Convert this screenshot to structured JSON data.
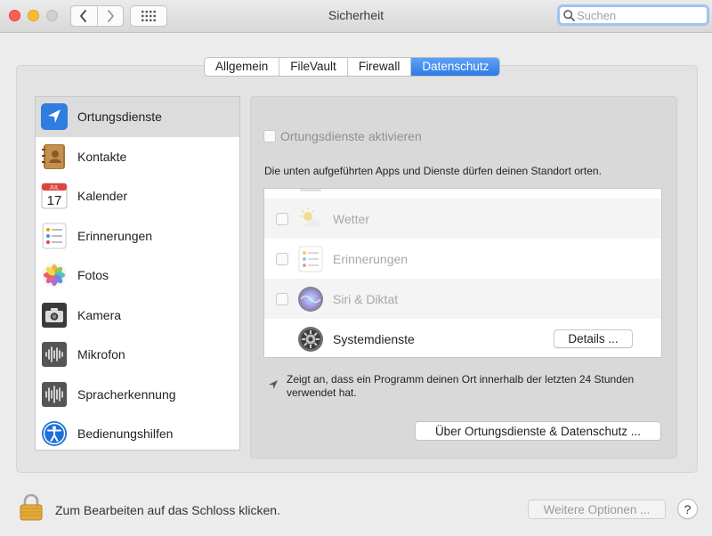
{
  "window": {
    "title": "Sicherheit",
    "search_placeholder": "Suchen"
  },
  "tabs": [
    {
      "label": "Allgemein",
      "active": false
    },
    {
      "label": "FileVault",
      "active": false
    },
    {
      "label": "Firewall",
      "active": false
    },
    {
      "label": "Datenschutz",
      "active": true
    }
  ],
  "sidebar": {
    "items": [
      {
        "label": "Ortungsdienste",
        "icon": "location-arrow-icon",
        "selected": true
      },
      {
        "label": "Kontakte",
        "icon": "contacts-book-icon"
      },
      {
        "label": "Kalender",
        "icon": "calendar-icon",
        "month": "JUL",
        "day": "17"
      },
      {
        "label": "Erinnerungen",
        "icon": "reminders-icon"
      },
      {
        "label": "Fotos",
        "icon": "photos-flower-icon"
      },
      {
        "label": "Kamera",
        "icon": "camera-icon"
      },
      {
        "label": "Mikrofon",
        "icon": "microphone-waveform-icon"
      },
      {
        "label": "Spracherkennung",
        "icon": "speech-waveform-icon"
      },
      {
        "label": "Bedienungshilfen",
        "icon": "accessibility-icon"
      }
    ]
  },
  "location": {
    "enable_label": "Ortungsdienste aktivieren",
    "enabled": false,
    "description": "Die unten aufgeführten Apps und Dienste dürfen deinen Standort orten.",
    "apps": [
      {
        "name": "Wetter",
        "icon": "weather-icon",
        "checked": false
      },
      {
        "name": "Erinnerungen",
        "icon": "reminders-icon",
        "checked": false
      },
      {
        "name": "Siri & Diktat",
        "icon": "siri-icon",
        "checked": false
      },
      {
        "name": "Systemdienste",
        "icon": "gear-icon"
      }
    ],
    "details_label": "Details ...",
    "note": "Zeigt an, dass ein Programm deinen Ort innerhalb der letzten 24 Stunden verwendet hat.",
    "about_label": "Über Ortungsdienste & Datenschutz ..."
  },
  "footer": {
    "lock_text": "Zum Bearbeiten auf das Schloss klicken.",
    "more_options": "Weitere Optionen ...",
    "help": "?"
  }
}
